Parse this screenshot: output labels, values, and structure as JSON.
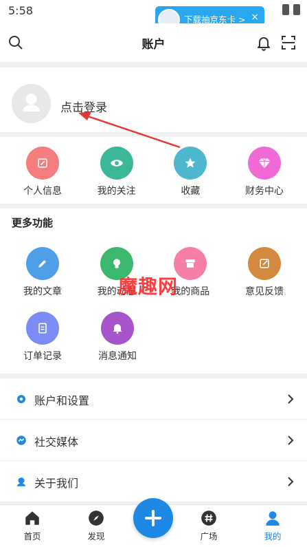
{
  "status": {
    "time": "5:58"
  },
  "ad": {
    "text": "下载抽京东卡 >",
    "close": "×"
  },
  "header": {
    "title": "账户"
  },
  "profile": {
    "login_text": "点击登录"
  },
  "quick_actions": [
    {
      "label": "个人信息",
      "color": "#f47d7d",
      "icon": "edit-profile-icon"
    },
    {
      "label": "我的关注",
      "color": "#3bb79a",
      "icon": "eye-icon"
    },
    {
      "label": "收藏",
      "color": "#4fb6d0",
      "icon": "star-icon"
    },
    {
      "label": "财务中心",
      "color": "#f06ad6",
      "icon": "diamond-icon"
    }
  ],
  "more": {
    "title": "更多功能",
    "items": [
      {
        "label": "我的文章",
        "color": "#4e9fe8",
        "icon": "pencil-icon"
      },
      {
        "label": "我的动态",
        "color": "#3cb86e",
        "icon": "bulb-icon"
      },
      {
        "label": "我的商品",
        "color": "#f77ea9",
        "icon": "shop-icon"
      },
      {
        "label": "意见反馈",
        "color": "#d3893e",
        "icon": "feedback-icon"
      },
      {
        "label": "订单记录",
        "color": "#7b8cf4",
        "icon": "clipboard-icon"
      },
      {
        "label": "消息通知",
        "color": "#a554c9",
        "icon": "bell-icon"
      }
    ]
  },
  "menu": [
    {
      "label": "账户和设置",
      "icon": "gear-icon"
    },
    {
      "label": "社交媒体",
      "icon": "messenger-icon"
    },
    {
      "label": "关于我们",
      "icon": "support-icon"
    }
  ],
  "tabs": [
    {
      "label": "首页",
      "icon": "home-icon"
    },
    {
      "label": "发现",
      "icon": "compass-icon"
    },
    {
      "label": "广场",
      "icon": "hashtag-icon"
    },
    {
      "label": "我的",
      "icon": "user-icon"
    }
  ],
  "watermark": "魔趣网",
  "colors": {
    "accent": "#1e88e5",
    "arrow": "#e53935"
  }
}
